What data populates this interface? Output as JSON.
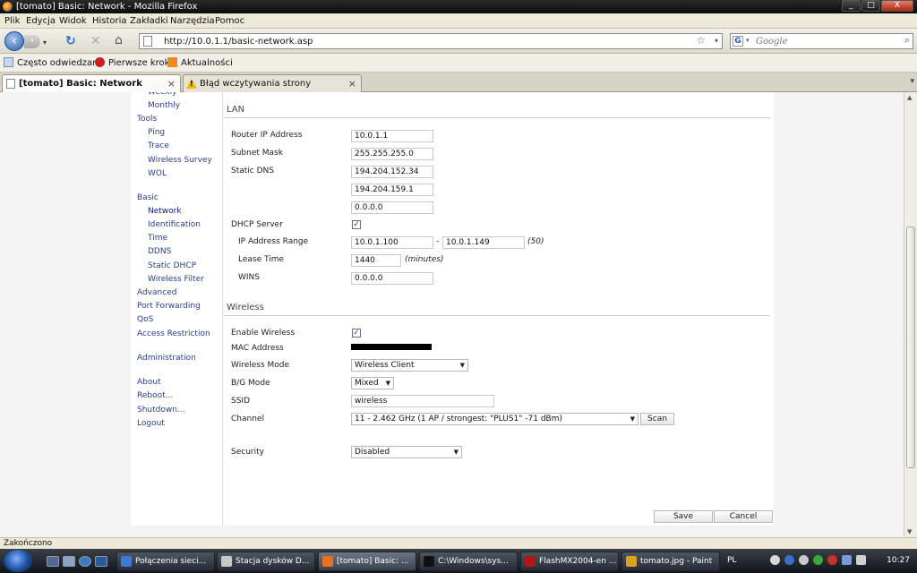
{
  "window": {
    "title": "[tomato] Basic: Network - Mozilla Firefox",
    "min": "_",
    "max": "□",
    "close": "X"
  },
  "menu": [
    "Plik",
    "Edycja",
    "Widok",
    "Historia",
    "Zakładki",
    "Narzędzia",
    "Pomoc"
  ],
  "nav": {
    "back": "‹",
    "forward": "›",
    "forward_drop": "▾",
    "reload": "↻",
    "stop": "✕",
    "home": "⌂",
    "url": "http://10.0.1.1/basic-network.asp",
    "star": "☆",
    "url_drop": "▾",
    "search_engine": "G",
    "search_drop": "▾",
    "search_placeholder": "Google",
    "search_icon": "⌕"
  },
  "bookmarks": [
    "Często odwiedzane",
    "Pierwsze kroki",
    "Aktualności"
  ],
  "tabs": [
    {
      "title": "[tomato] Basic: Network",
      "close": "×"
    },
    {
      "title": "Błąd wczytywania strony",
      "close": "×"
    }
  ],
  "tab_scroll": "▾",
  "sidebar": {
    "items": [
      {
        "label": "Weekly",
        "type": "sub"
      },
      {
        "label": "Monthly",
        "type": "sub"
      },
      {
        "label": "Tools",
        "type": "top"
      },
      {
        "label": "Ping",
        "type": "sub"
      },
      {
        "label": "Trace",
        "type": "sub"
      },
      {
        "label": "Wireless Survey",
        "type": "sub"
      },
      {
        "label": "WOL",
        "type": "sub"
      },
      {
        "label": "Basic",
        "type": "top"
      },
      {
        "label": "Network",
        "type": "sub",
        "active": true
      },
      {
        "label": "Identification",
        "type": "sub"
      },
      {
        "label": "Time",
        "type": "sub"
      },
      {
        "label": "DDNS",
        "type": "sub"
      },
      {
        "label": "Static DHCP",
        "type": "sub"
      },
      {
        "label": "Wireless Filter",
        "type": "sub"
      },
      {
        "label": "Advanced",
        "type": "top"
      },
      {
        "label": "Port Forwarding",
        "type": "top"
      },
      {
        "label": "QoS",
        "type": "top"
      },
      {
        "label": "Access Restriction",
        "type": "top"
      },
      {
        "label": "Administration",
        "type": "top"
      },
      {
        "label": "About",
        "type": "top"
      },
      {
        "label": "Reboot...",
        "type": "top"
      },
      {
        "label": "Shutdown...",
        "type": "top"
      },
      {
        "label": "Logout",
        "type": "top"
      }
    ]
  },
  "lan": {
    "title": "LAN",
    "router_ip_label": "Router IP Address",
    "router_ip": "10.0.1.1",
    "subnet_label": "Subnet Mask",
    "subnet": "255.255.255.0",
    "dns_label": "Static DNS",
    "dns1": "194.204.152.34",
    "dns2": "194.204.159.1",
    "dns3": "0.0.0.0",
    "dhcp_label": "DHCP Server",
    "dhcp_checked": "✓",
    "range_label": "IP Address Range",
    "range_start": "10.0.1.100",
    "range_dash": "-",
    "range_end": "10.0.1.149",
    "range_count": "(50)",
    "lease_label": "Lease Time",
    "lease": "1440",
    "lease_unit": "(minutes)",
    "wins_label": "WINS",
    "wins": "0.0.0.0"
  },
  "wireless": {
    "title": "Wireless",
    "enable_label": "Enable Wireless",
    "enable_checked": "✓",
    "mac_label": "MAC Address",
    "mode_label": "Wireless Mode",
    "mode": "Wireless Client",
    "bg_label": "B/G Mode",
    "bg": "Mixed",
    "ssid_label": "SSID",
    "ssid": "wireless",
    "channel_label": "Channel",
    "channel": "11 - 2.462 GHz (1 AP / strongest: \"PLUS1\" -71 dBm)",
    "scan": "Scan",
    "security_label": "Security",
    "security": "Disabled",
    "drop": "▼"
  },
  "actions": {
    "save": "Save",
    "cancel": "Cancel"
  },
  "status": "Zakończono",
  "taskbar": {
    "tasks": [
      {
        "label": "Połączenia sieci...",
        "color": "#3a7bd5"
      },
      {
        "label": "Stacja dysków D...",
        "color": "#c8c8c8"
      },
      {
        "label": "[tomato] Basic: ...",
        "color": "#e8731a"
      },
      {
        "label": "C:\\Windows\\sys...",
        "color": "#111111"
      },
      {
        "label": "FlashMX2004-en ...",
        "color": "#b01818"
      },
      {
        "label": "tomato.jpg - Paint",
        "color": "#d9a21f"
      }
    ],
    "lang": "PL",
    "clock": "10:27"
  },
  "colors": {
    "link": "#2a3d8e",
    "page_bg": "#ffffff"
  }
}
